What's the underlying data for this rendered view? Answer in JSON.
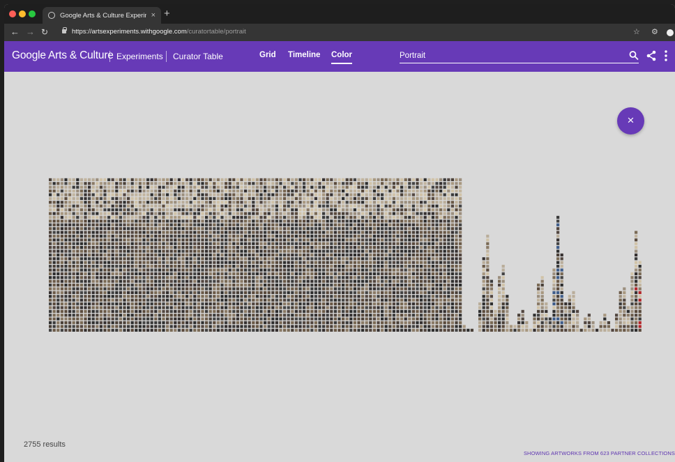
{
  "browser": {
    "tab_title": "Google Arts & Culture Experim",
    "tab_close": "×",
    "new_tab": "+",
    "url_domain": "https://artsexperiments.withgoogle.com",
    "url_path": "/curatortable/portrait",
    "icons": [
      "back-arrow-icon",
      "forward-arrow-icon",
      "reload-icon",
      "lock-icon",
      "star-icon",
      "extension-icon",
      "profile-icon"
    ]
  },
  "header": {
    "brand": "Google Arts & Culture",
    "breadcrumb": [
      "Experiments",
      "Curator Table"
    ],
    "nav": [
      "Grid",
      "Timeline",
      "Color"
    ],
    "active_nav": "Color",
    "search_value": "Portrait",
    "accent_color": "#673ab7",
    "icons": [
      "search-icon",
      "share-icon",
      "more-vert-icon"
    ]
  },
  "main": {
    "close_label": "×",
    "results": "2755 results",
    "collections_note": "SHOWING ARTWORKS FROM 623 PARTNER COLLECTIONS",
    "background_color": "#d9d9d9"
  }
}
